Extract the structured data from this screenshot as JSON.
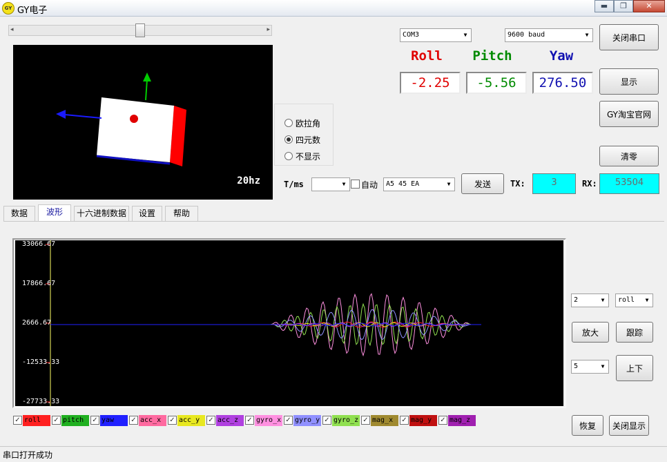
{
  "window": {
    "icon_text": "GY",
    "title": "GY电子",
    "minimize": "▬",
    "maximize": "❐",
    "close": "✕"
  },
  "slider": {
    "left_arrow": "◂",
    "right_arrow": "▸"
  },
  "view3d": {
    "rate": "20hz",
    "colors": {
      "box": "#ffffff",
      "side": "#ff0000",
      "x_axis": "#1a1aff",
      "y_axis": "#00cc00",
      "dot": "#e00000"
    }
  },
  "display_mode": {
    "options": [
      "欧拉角",
      "四元数",
      "不显示"
    ],
    "selected": "四元数"
  },
  "serial": {
    "port": "COM3",
    "baud": "9600 baud",
    "close_button": "关闭串口",
    "show_button": "显示",
    "website_button": "GY淘宝官网",
    "zero_button": "清零"
  },
  "orientation": {
    "roll_label": "Roll",
    "pitch_label": "Pitch",
    "yaw_label": "Yaw",
    "roll": "-2.25",
    "pitch": "-5.56",
    "yaw": "276.50",
    "colors": {
      "roll": "#e00000",
      "pitch": "#008a00",
      "yaw": "#1010b0"
    }
  },
  "send": {
    "period_label": "T/ms",
    "period_value": "",
    "auto_label": "自动",
    "command": "A5 45 EA",
    "send_button": "发送",
    "tx_label": "TX:",
    "tx": "3",
    "rx_label": "RX:",
    "rx": "53504"
  },
  "tabs": [
    "数据",
    "波形",
    "十六进制数据",
    "设置",
    "帮助"
  ],
  "active_tab": "波形",
  "plot": {
    "yticks": [
      "33066.67",
      "17866.67",
      "2666.67",
      "-12533.33",
      "-27733.33"
    ]
  },
  "plot_controls": {
    "scale": "2",
    "channel": "roll",
    "zoom_button": "放大",
    "track_button": "跟踪",
    "step": "5",
    "updown_button": "上下",
    "restore_button": "恢复",
    "close_display_button": "关闭显示"
  },
  "legend": [
    {
      "label": "roll",
      "color": "#ff2020",
      "checked": true
    },
    {
      "label": "pitch",
      "color": "#20b020",
      "checked": true
    },
    {
      "label": "yaw",
      "color": "#2020ff",
      "checked": true
    },
    {
      "label": "acc_x",
      "color": "#ff6aa0",
      "checked": true
    },
    {
      "label": "acc_y",
      "color": "#e8e820",
      "checked": true
    },
    {
      "label": "acc_z",
      "color": "#b040e0",
      "checked": true
    },
    {
      "label": "gyro_x",
      "color": "#ff90e0",
      "checked": true
    },
    {
      "label": "gyro_y",
      "color": "#9090ff",
      "checked": true
    },
    {
      "label": "gyro_z",
      "color": "#90e050",
      "checked": true
    },
    {
      "label": "mag_x",
      "color": "#a08a30",
      "checked": true
    },
    {
      "label": "mag_y",
      "color": "#c01010",
      "checked": true
    },
    {
      "label": "mag_z",
      "color": "#a020b0",
      "checked": true
    }
  ],
  "status": "串口打开成功"
}
